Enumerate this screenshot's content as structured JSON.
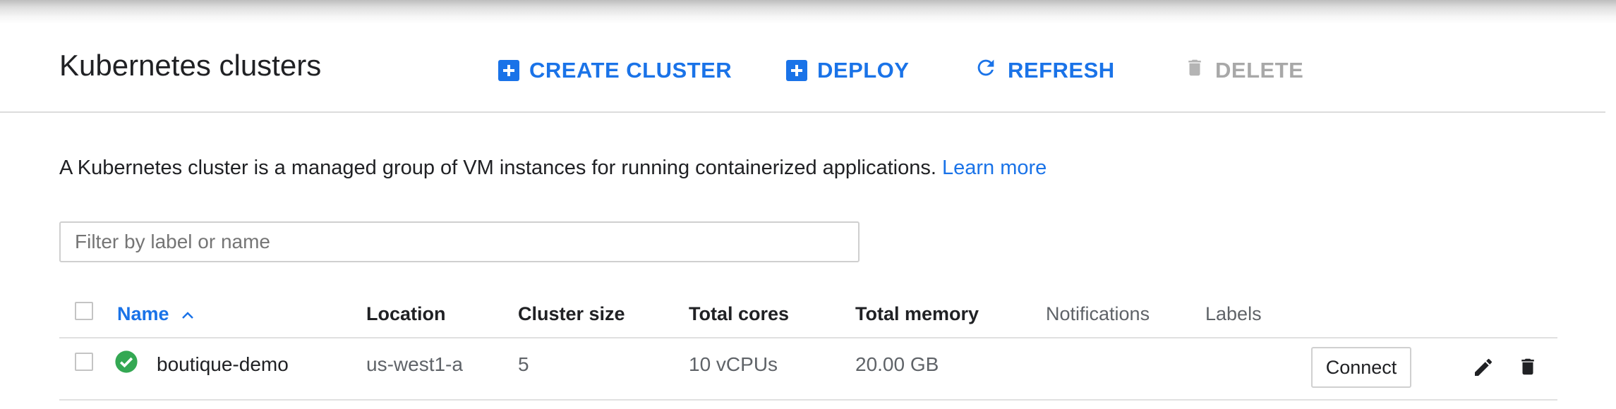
{
  "header": {
    "title": "Kubernetes clusters",
    "actions": {
      "create": "CREATE CLUSTER",
      "deploy": "DEPLOY",
      "refresh": "REFRESH",
      "delete": "DELETE"
    }
  },
  "description": {
    "text": "A Kubernetes cluster is a managed group of VM instances for running containerized applications.",
    "link": "Learn more"
  },
  "filter": {
    "placeholder": "Filter by label or name",
    "value": ""
  },
  "table": {
    "columns": {
      "name": "Name",
      "location": "Location",
      "cluster_size": "Cluster size",
      "total_cores": "Total cores",
      "total_memory": "Total memory",
      "notifications": "Notifications",
      "labels": "Labels"
    },
    "sort_indicator": "^",
    "rows": [
      {
        "status": "ok",
        "name": "boutique-demo",
        "location": "us-west1-a",
        "cluster_size": "5",
        "total_cores": "10 vCPUs",
        "total_memory": "20.00 GB",
        "notifications": "",
        "labels": "",
        "connect_label": "Connect"
      }
    ]
  },
  "icons": {
    "create": "add-box-icon",
    "deploy": "add-box-icon",
    "refresh": "refresh-icon",
    "delete": "trash-icon",
    "status": "check-circle-icon",
    "edit": "pencil-icon",
    "row_delete": "trash-icon"
  },
  "colors": {
    "accent": "#1a73e8",
    "success": "#34a853",
    "disabled": "#a8a8a8",
    "text": "#202124",
    "muted": "#5f6368"
  }
}
